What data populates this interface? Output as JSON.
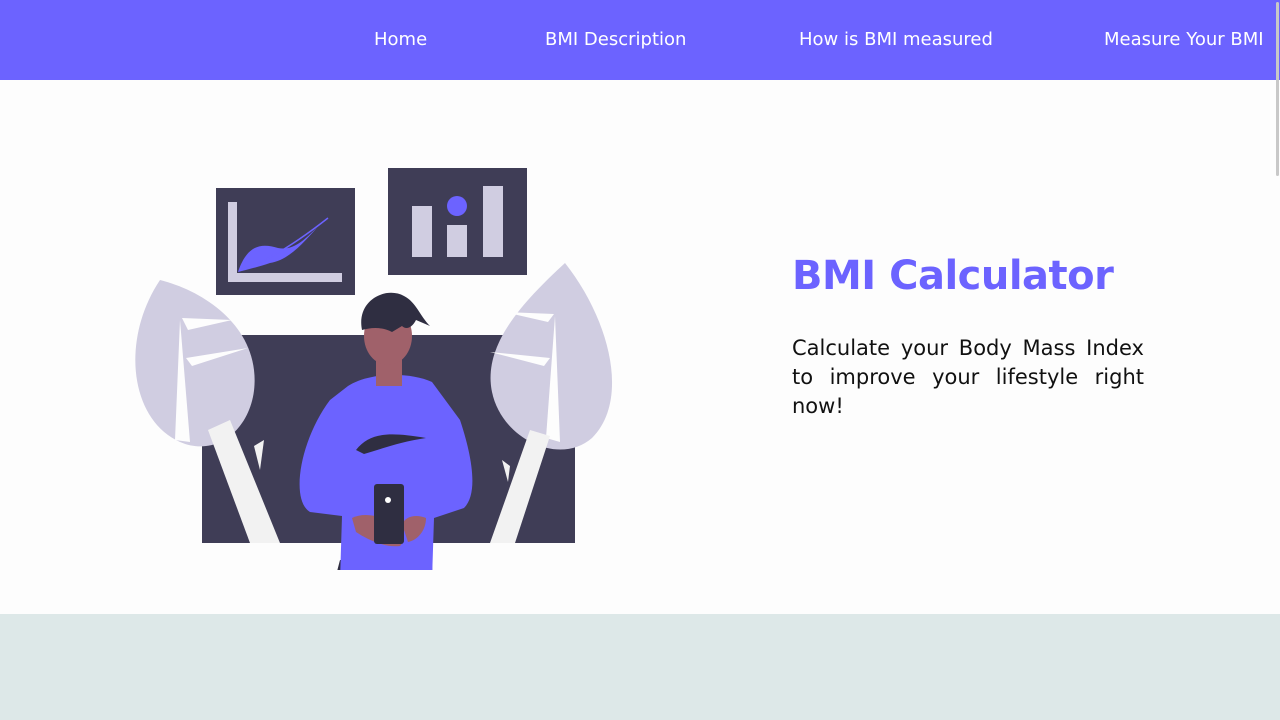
{
  "nav": {
    "links": [
      {
        "label": "Home"
      },
      {
        "label": "BMI Description"
      },
      {
        "label": "How is BMI measured"
      },
      {
        "label": "Measure Your BMI"
      }
    ]
  },
  "hero": {
    "title": "BMI Calculator",
    "subtitle": "Calculate your Body Mass Index to improve your lifestyle right now!",
    "illustration_icon": "person-with-phone-and-charts-illustration"
  },
  "colors": {
    "accent": "#6c63ff",
    "dark": "#3f3d56",
    "leaf": "#d0cde1",
    "band": "#dde8e8",
    "skin": "#a0616a"
  }
}
